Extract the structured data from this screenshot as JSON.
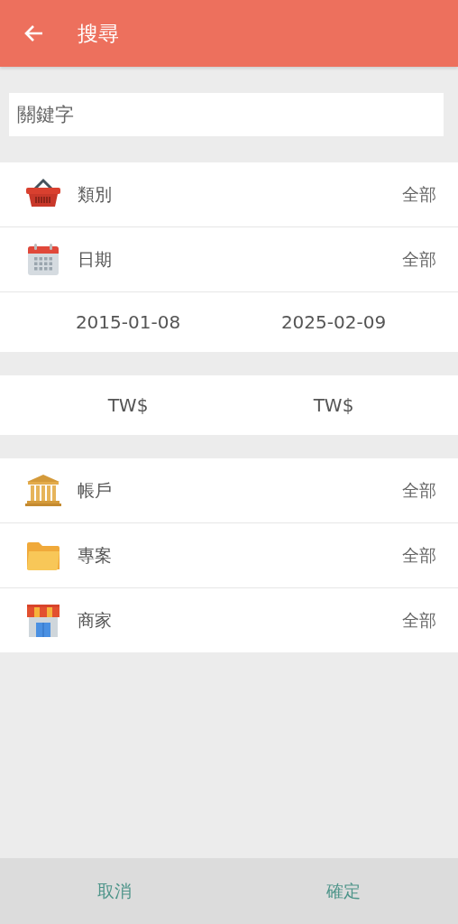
{
  "header": {
    "title": "搜尋"
  },
  "search": {
    "placeholder": "關鍵字"
  },
  "sections": [
    {
      "rows": [
        {
          "kind": "basket",
          "label": "類別",
          "value": "全部"
        },
        {
          "kind": "calendar",
          "label": "日期",
          "value": "全部"
        },
        {
          "kind": "range",
          "from": "2015-01-08",
          "to": "2025-02-09"
        }
      ]
    },
    {
      "rows": [
        {
          "kind": "range",
          "from": "TW$",
          "to": "TW$"
        }
      ]
    },
    {
      "rows": [
        {
          "kind": "bank",
          "label": "帳戶",
          "value": "全部"
        },
        {
          "kind": "folder",
          "label": "專案",
          "value": "全部"
        },
        {
          "kind": "store",
          "label": "商家",
          "value": "全部"
        }
      ]
    }
  ],
  "buttons": [
    {
      "label": "取消"
    },
    {
      "label": "確定"
    }
  ]
}
